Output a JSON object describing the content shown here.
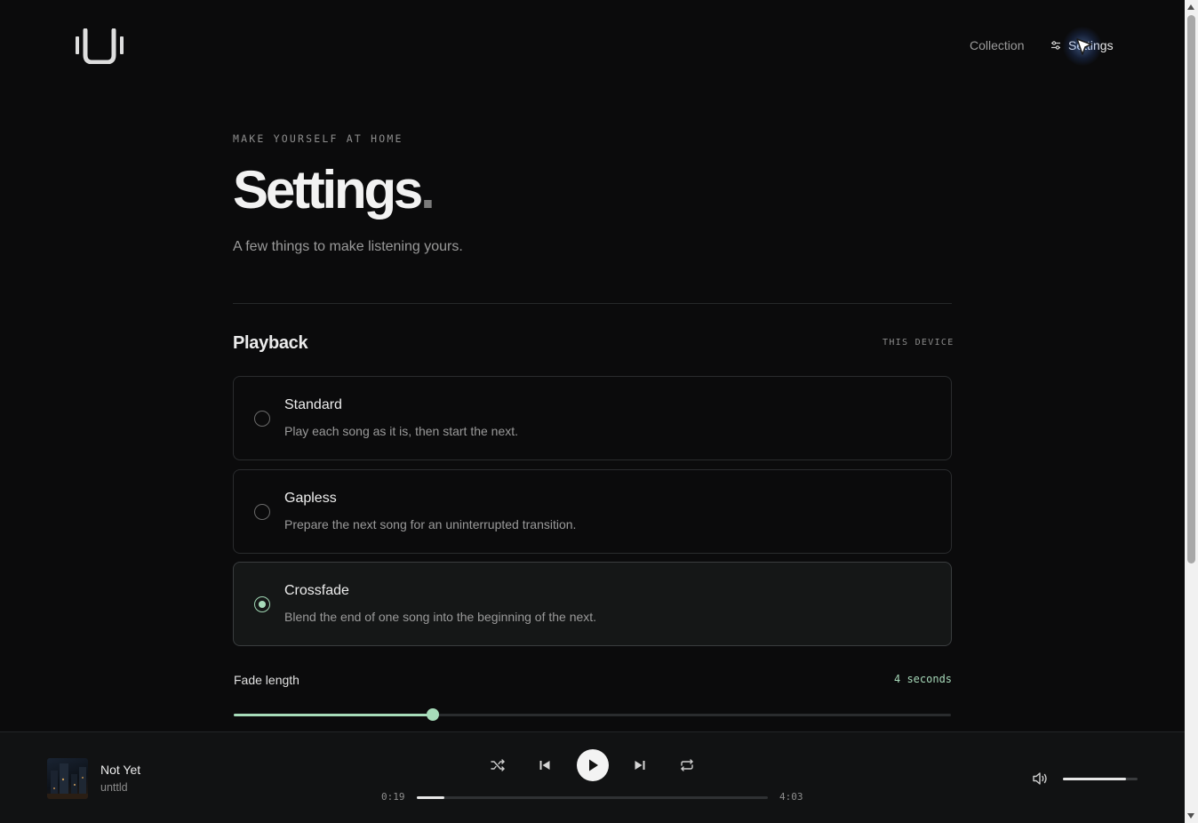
{
  "nav": {
    "collection_label": "Collection",
    "settings_label": "Settings"
  },
  "header": {
    "eyebrow": "MAKE YOURSELF AT HOME",
    "title": "Settings",
    "title_dot": ".",
    "subtitle": "A few things to make listening yours."
  },
  "playback": {
    "section_title": "Playback",
    "section_tag": "THIS DEVICE",
    "options": [
      {
        "label": "Standard",
        "description": "Play each song as it is, then start the next.",
        "selected": false
      },
      {
        "label": "Gapless",
        "description": "Prepare the next song for an uninterrupted transition.",
        "selected": false
      },
      {
        "label": "Crossfade",
        "description": "Blend the end of one song into the beginning of the next.",
        "selected": true
      }
    ],
    "fade_length": {
      "label": "Fade length",
      "value_text": "4 seconds",
      "level_fraction": 0.277
    }
  },
  "player": {
    "track_title": "Not Yet",
    "track_artist": "unttld",
    "elapsed": "0:19",
    "duration": "4:03",
    "progress_fraction": 0.078,
    "volume_fraction": 0.85,
    "icons": [
      "shuffle-icon",
      "previous-icon",
      "play-icon",
      "next-icon",
      "repeat-icon",
      "volume-icon"
    ]
  },
  "colors": {
    "background": "#0b0b0c",
    "accent": "#a7dcba",
    "player_background": "#111213"
  }
}
